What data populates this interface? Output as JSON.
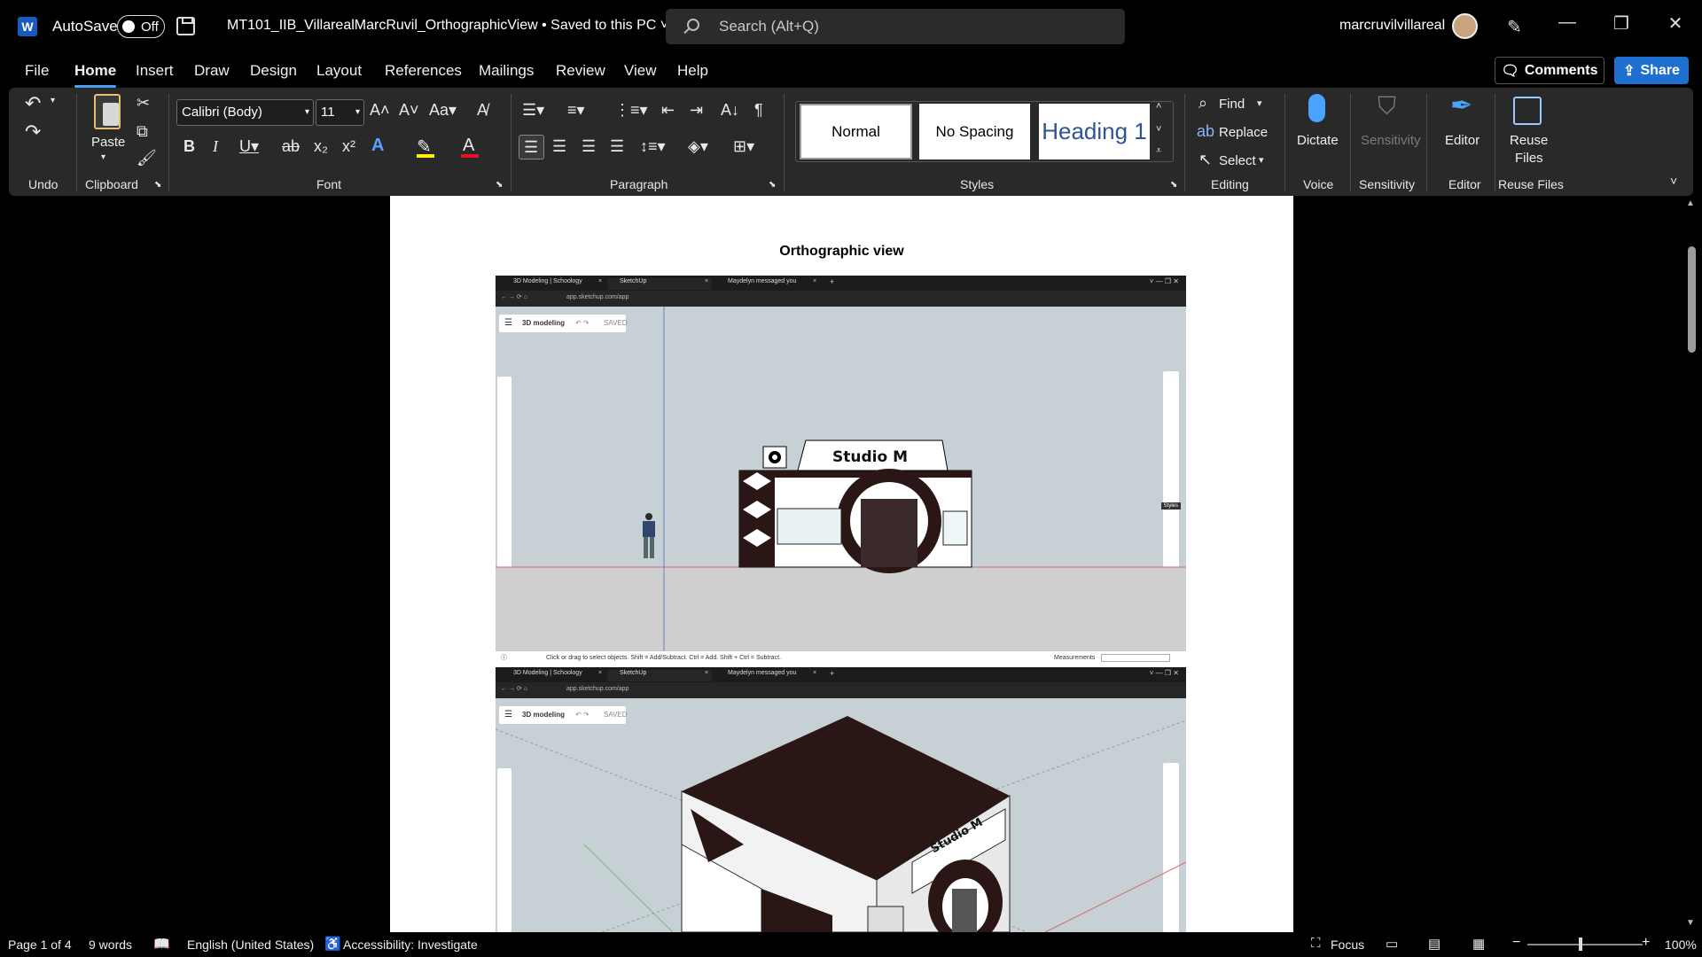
{
  "titlebar": {
    "app_icon": "W",
    "autosave_label": "AutoSave",
    "autosave_state": "Off",
    "document_title": "MT101_IIB_VillarealMarcRuvil_OrthographicView • Saved to this PC ˅",
    "search_placeholder": "Search (Alt+Q)",
    "user_name": "marcruvilvillareal"
  },
  "menu": {
    "tabs": [
      "File",
      "Home",
      "Insert",
      "Draw",
      "Design",
      "Layout",
      "References",
      "Mailings",
      "Review",
      "View",
      "Help"
    ],
    "active_tab": "Home",
    "comments_label": "Comments",
    "share_label": "Share"
  },
  "ribbon": {
    "groups": {
      "undo": "Undo",
      "clipboard": "Clipboard",
      "font": "Font",
      "paragraph": "Paragraph",
      "styles": "Styles",
      "editing": "Editing",
      "voice": "Voice",
      "sensitivity": "Sensitivity",
      "editor": "Editor",
      "reuse_files": "Reuse Files"
    },
    "paste_label": "Paste",
    "font_name": "Calibri (Body)",
    "font_size": "11",
    "styles": [
      "Normal",
      "No Spacing",
      "Heading 1"
    ],
    "find_label": "Find",
    "replace_label": "Replace",
    "select_label": "Select",
    "dictate_label": "Dictate",
    "sensitivity_label": "Sensitivity",
    "editor_label": "Editor",
    "reuse_label_1": "Reuse",
    "reuse_label_2": "Files"
  },
  "document": {
    "heading": "Orthographic view",
    "screenshot1": {
      "tab1": "3D Modeling | Schoology",
      "tab2": "SketchUp",
      "tab3": "Maydelyn messaged you",
      "url": "app.sketchup.com/app",
      "panel_title": "3D modeling",
      "panel_status": "SAVED",
      "sign_text": "Studio M",
      "status_text": "Click or drag to select objects. Shift = Add/Subtract. Ctrl = Add. Shift + Ctrl = Subtract.",
      "measurements": "Measurements",
      "tooltip": "Styles"
    },
    "screenshot2": {
      "tab1": "3D Modeling | Schoology",
      "tab2": "SketchUp",
      "tab3": "Maydelyn messaged you",
      "url": "app.sketchup.com/app",
      "panel_title": "3D modeling",
      "panel_status": "SAVED",
      "sign_text": "Studio M"
    }
  },
  "statusbar": {
    "page": "Page 1 of 4",
    "words": "9 words",
    "language": "English (United States)",
    "accessibility": "Accessibility: Investigate",
    "focus": "Focus",
    "zoom": "100%"
  },
  "colors": {
    "accent": "#4a9ff5",
    "share": "#1f6fd1",
    "ribbon": "#292929",
    "word_blue": "#185abd",
    "building_dark": "#2b1616"
  }
}
